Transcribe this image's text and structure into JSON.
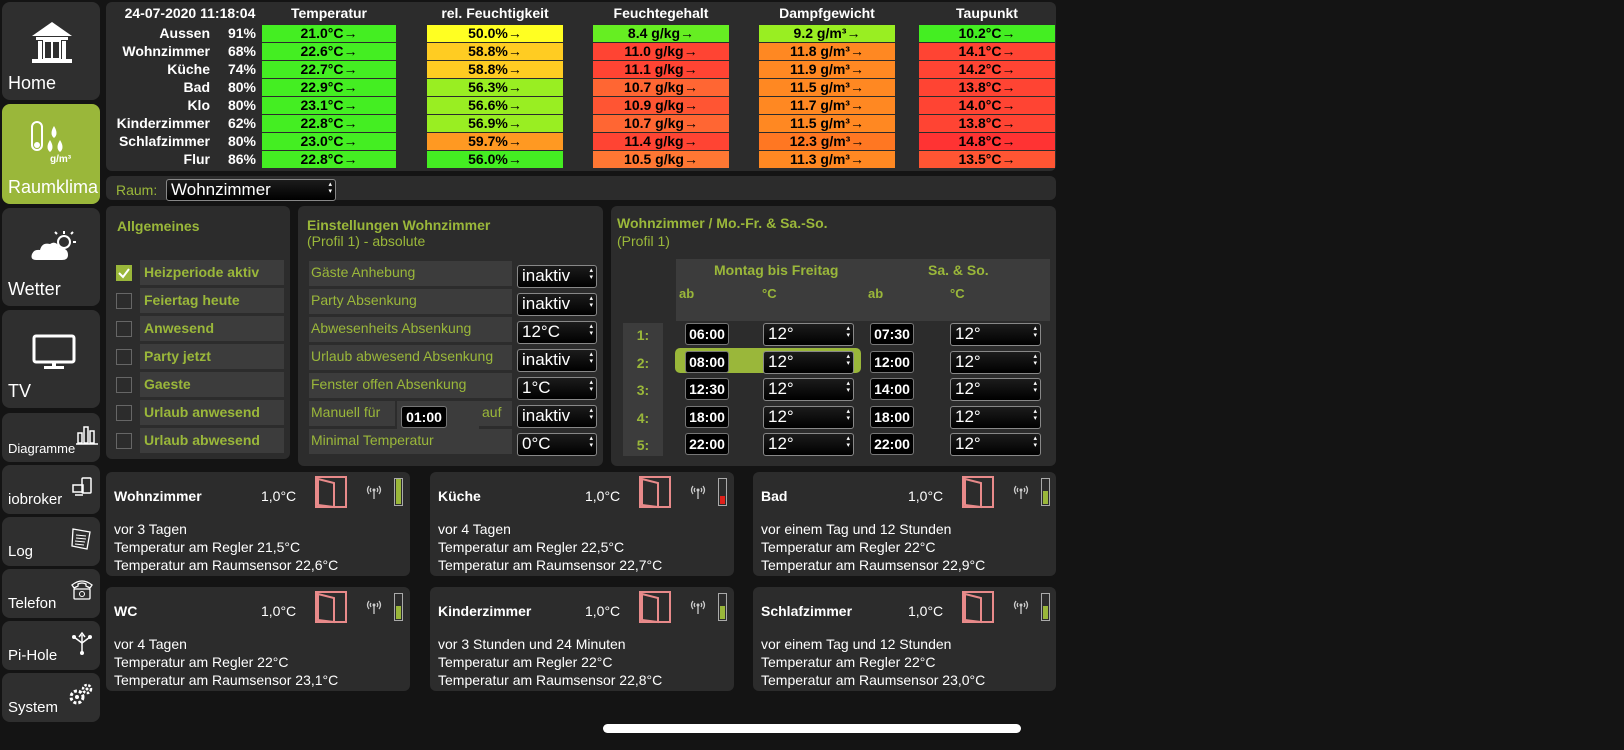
{
  "nav": [
    {
      "label": "Home",
      "icon": "house-icon"
    },
    {
      "label": "Raumklima",
      "icon": "humidity-icon",
      "sub": "g/m³"
    },
    {
      "label": "Wetter",
      "icon": "weather-icon"
    },
    {
      "label": "TV",
      "icon": "tv-icon"
    },
    {
      "label": "Diagramme",
      "icon": "bar-chart-icon"
    },
    {
      "label": "iobroker",
      "icon": "devices-icon"
    },
    {
      "label": "Log",
      "icon": "log-icon"
    },
    {
      "label": "Telefon",
      "icon": "phone-icon"
    },
    {
      "label": "Pi-Hole",
      "icon": "network-icon"
    },
    {
      "label": "System",
      "icon": "gears-icon"
    }
  ],
  "climate": {
    "timestamp": "24-07-2020 11:18:04",
    "headers": [
      "Temperatur",
      "rel. Feuchtigkeit",
      "Feuchtegehalt",
      "Dampfgewicht",
      "Taupunkt"
    ],
    "rows": [
      {
        "name": "Aussen",
        "pct": "91%",
        "temp": "21.0°C→",
        "rh": "50.0%→",
        "fg": "8.4 g/kg→",
        "dg": "9.2 g/m³→",
        "tp": "10.2°C→"
      },
      {
        "name": "Wohnzimmer",
        "pct": "68%",
        "temp": "22.6°C→",
        "rh": "58.8%→",
        "fg": "11.0 g/kg→",
        "dg": "11.8 g/m³→",
        "tp": "14.1°C→"
      },
      {
        "name": "Küche",
        "pct": "74%",
        "temp": "22.7°C→",
        "rh": "58.8%→",
        "fg": "11.1 g/kg→",
        "dg": "11.9 g/m³→",
        "tp": "14.2°C→"
      },
      {
        "name": "Bad",
        "pct": "80%",
        "temp": "22.9°C→",
        "rh": "56.3%→",
        "fg": "10.7 g/kg→",
        "dg": "11.5 g/m³→",
        "tp": "13.8°C→"
      },
      {
        "name": "Klo",
        "pct": "80%",
        "temp": "23.1°C→",
        "rh": "56.6%→",
        "fg": "10.9 g/kg→",
        "dg": "11.7 g/m³→",
        "tp": "14.0°C→"
      },
      {
        "name": "Kinderzimmer",
        "pct": "62%",
        "temp": "22.8°C→",
        "rh": "56.9%→",
        "fg": "10.7 g/kg→",
        "dg": "11.5 g/m³→",
        "tp": "13.8°C→"
      },
      {
        "name": "Schlafzimmer",
        "pct": "80%",
        "temp": "23.0°C→",
        "rh": "59.7%→",
        "fg": "11.4 g/kg→",
        "dg": "12.3 g/m³→",
        "tp": "14.8°C→"
      },
      {
        "name": "Flur",
        "pct": "86%",
        "temp": "22.8°C→",
        "rh": "56.0%→",
        "fg": "10.5 g/kg→",
        "dg": "11.3 g/m³→",
        "tp": "13.5°C→"
      }
    ],
    "colors": {
      "rh": [
        "#ffff22",
        "#ffcc22",
        "#ffcc22",
        "#99ee22",
        "#99ee22",
        "#99ee22",
        "#ff9922",
        "#44ee22"
      ],
      "fg": [
        "#66ee22",
        "#ff4433",
        "#ff4433",
        "#ff6633",
        "#ff5533",
        "#ff6633",
        "#ff4433",
        "#ff7733"
      ],
      "dg": [
        "#99ee22",
        "#ff8822",
        "#ff8822",
        "#ff8822",
        "#ff8822",
        "#ff8822",
        "#ff7722",
        "#ff8822"
      ],
      "tp": [
        "#44ee22",
        "#ff4433",
        "#ff4433",
        "#ff4433",
        "#ff4433",
        "#ff4433",
        "#ff3333",
        "#ff5533"
      ],
      "temp": "#44ee22"
    }
  },
  "room": {
    "label": "Raum:",
    "value": "Wohnzimmer"
  },
  "general": {
    "title": "Allgemeines",
    "items": [
      {
        "label": "Heizperiode aktiv",
        "checked": true
      },
      {
        "label": "Feiertag heute",
        "checked": false
      },
      {
        "label": "Anwesend",
        "checked": false
      },
      {
        "label": "Party jetzt",
        "checked": false
      },
      {
        "label": "Gaeste",
        "checked": false
      },
      {
        "label": "Urlaub anwesend",
        "checked": false
      },
      {
        "label": "Urlaub abwesend",
        "checked": false
      }
    ]
  },
  "settings": {
    "title": "Einstellungen Wohnzimmer",
    "subtitle": "(Profil 1) - absolute",
    "rows": [
      {
        "label": "Gäste Anhebung",
        "value": "inaktiv"
      },
      {
        "label": "Party Absenkung",
        "value": "inaktiv"
      },
      {
        "label": "Abwesenheits Absenkung",
        "value": "12°C"
      },
      {
        "label": "Urlaub abwesend Absenkung",
        "value": "inaktiv"
      },
      {
        "label": "Fenster offen Absenkung",
        "value": "1°C"
      },
      {
        "label": "Manuell für",
        "value": "inaktiv",
        "time": "01:00",
        "auf": "auf"
      },
      {
        "label": "Minimal Temperatur",
        "value": "0°C"
      }
    ]
  },
  "schedule": {
    "title": "Wohnzimmer / Mo.-Fr. & Sa.-So.",
    "subtitle": "(Profil 1)",
    "weekday_header": "Montag bis Freitag",
    "weekend_header": "Sa. & So.",
    "col_ab": "ab",
    "col_c": "°C",
    "rows": [
      {
        "n": "1:",
        "wd_time": "06:00",
        "wd_temp": "12°",
        "we_time": "07:30",
        "we_temp": "12°"
      },
      {
        "n": "2:",
        "wd_time": "08:00",
        "wd_temp": "12°",
        "we_time": "12:00",
        "we_temp": "12°"
      },
      {
        "n": "3:",
        "wd_time": "12:30",
        "wd_temp": "12°",
        "we_time": "14:00",
        "we_temp": "12°"
      },
      {
        "n": "4:",
        "wd_time": "18:00",
        "wd_temp": "12°",
        "we_time": "18:00",
        "we_temp": "12°"
      },
      {
        "n": "5:",
        "wd_time": "22:00",
        "wd_temp": "12°",
        "we_time": "22:00",
        "we_temp": "12°"
      }
    ]
  },
  "cards": [
    {
      "name": "Wohnzimmer",
      "temp": "1,0°C",
      "ago": "vor 3 Tagen",
      "regler": "Temperatur am Regler 21,5°C",
      "sensor": "Temperatur am Raumsensor 22,6°C",
      "battery": "#9ab73a",
      "battery_level": 0.95
    },
    {
      "name": "Küche",
      "temp": "1,0°C",
      "ago": "vor 4 Tagen",
      "regler": "Temperatur am Regler 22,5°C",
      "sensor": "Temperatur am Raumsensor 22,7°C",
      "battery": "#e0201a",
      "battery_level": 0.3
    },
    {
      "name": "Bad",
      "temp": "1,0°C",
      "ago": "vor einem Tag und 12 Stunden",
      "regler": "Temperatur am Regler 22°C",
      "sensor": "Temperatur am Raumsensor 22,9°C",
      "battery": "#9ab73a",
      "battery_level": 0.5
    },
    {
      "name": "WC",
      "temp": "1,0°C",
      "ago": "vor 4 Tagen",
      "regler": "Temperatur am Regler 22°C",
      "sensor": "Temperatur am Raumsensor 23,1°C",
      "battery": "#9ab73a",
      "battery_level": 0.5
    },
    {
      "name": "Kinderzimmer",
      "temp": "1,0°C",
      "ago": "vor 3 Stunden und 24 Minuten",
      "regler": "Temperatur am Regler 22°C",
      "sensor": "Temperatur am Raumsensor 22,8°C",
      "battery": "#9ab73a",
      "battery_level": 0.5
    },
    {
      "name": "Schlafzimmer",
      "temp": "1,0°C",
      "ago": "vor einem Tag und 12 Stunden",
      "regler": "Temperatur am Regler 22°C",
      "sensor": "Temperatur am Raumsensor 23,0°C",
      "battery": "#9ab73a",
      "battery_level": 0.5
    }
  ]
}
